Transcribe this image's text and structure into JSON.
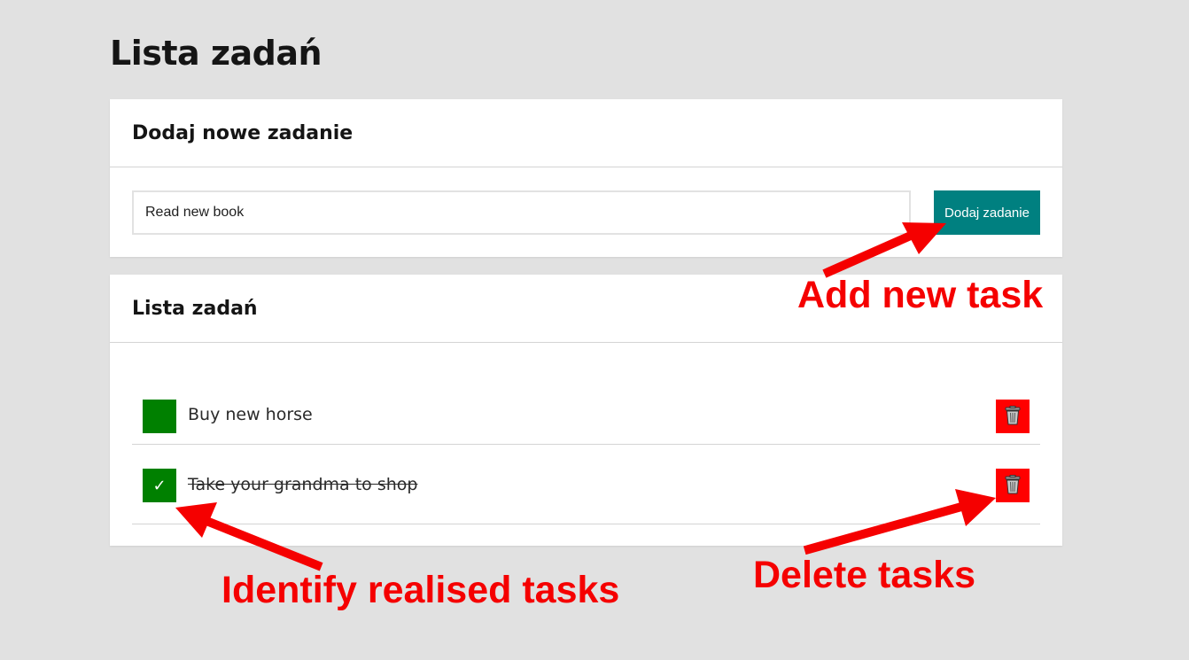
{
  "page": {
    "title": "Lista zadań"
  },
  "add_form": {
    "header": "Dodaj nowe zadanie",
    "input_value": "Read new book",
    "button_label": "Dodaj zadanie"
  },
  "task_list": {
    "header": "Lista zadań",
    "tasks": [
      {
        "text": "Buy new horse",
        "done": false,
        "check_glyph": ""
      },
      {
        "text": "Take your grandma to shop",
        "done": true,
        "check_glyph": "✓"
      }
    ],
    "delete_icon": "trash-icon"
  },
  "annotations": {
    "add": "Add new task",
    "identify": "Identify realised tasks",
    "delete": "Delete tasks"
  },
  "colors": {
    "background": "#e1e1e1",
    "card": "#ffffff",
    "add_button": "#008080",
    "checkbox": "#008000",
    "delete_button": "#ff0000",
    "annotation": "#f50000"
  }
}
